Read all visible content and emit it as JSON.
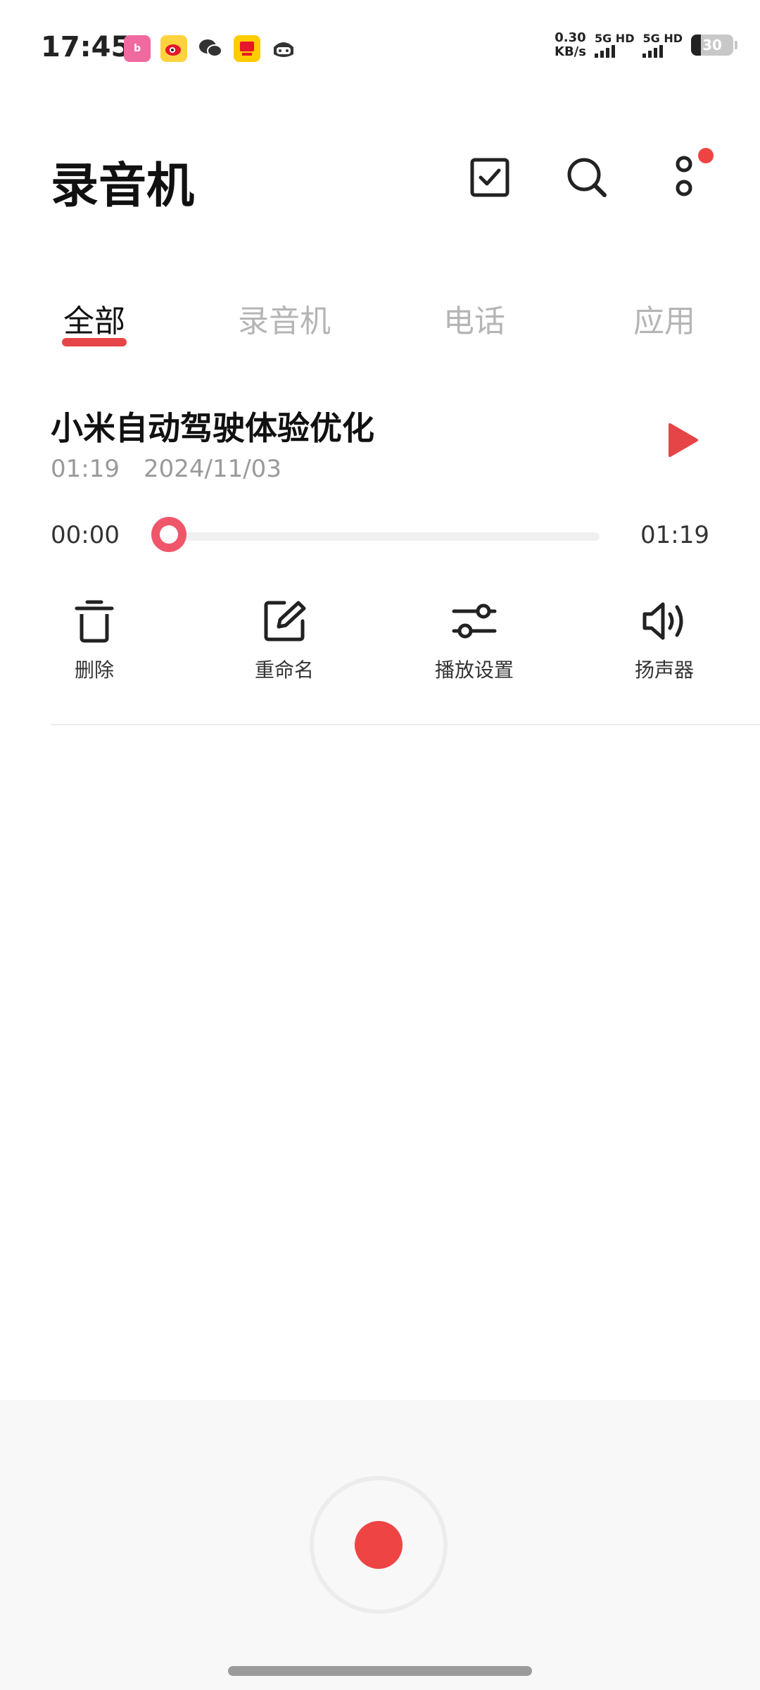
{
  "status_bar": {
    "time": "17:45",
    "net_speed_value": "0.30",
    "net_speed_unit": "KB/s",
    "sim1_label": "5G HD",
    "sim2_label": "5G HD",
    "battery": "30",
    "app_icons": [
      "bilibili-icon",
      "weibo-icon",
      "wechat-icon",
      "app-icon",
      "mascot-icon"
    ]
  },
  "header": {
    "title": "录音机",
    "icons": [
      "checkbox-icon",
      "search-icon",
      "more-icon"
    ]
  },
  "tabs": [
    {
      "label": "全部",
      "active": true
    },
    {
      "label": "录音机",
      "active": false
    },
    {
      "label": "电话",
      "active": false
    },
    {
      "label": "应用",
      "active": false
    }
  ],
  "recording": {
    "title": "小米自动驾驶体验优化",
    "duration": "01:19",
    "date": "2024/11/03",
    "current_time": "00:00",
    "total_time": "01:19",
    "progress": 0.0
  },
  "actions": [
    {
      "label": "删除",
      "icon": "trash-icon"
    },
    {
      "label": "重命名",
      "icon": "edit-icon"
    },
    {
      "label": "播放设置",
      "icon": "settings-sliders-icon"
    },
    {
      "label": "扬声器",
      "icon": "speaker-icon"
    }
  ],
  "colors": {
    "accent": "#e64547",
    "record": "#ef4444",
    "muted_text": "#9a9a9a"
  }
}
